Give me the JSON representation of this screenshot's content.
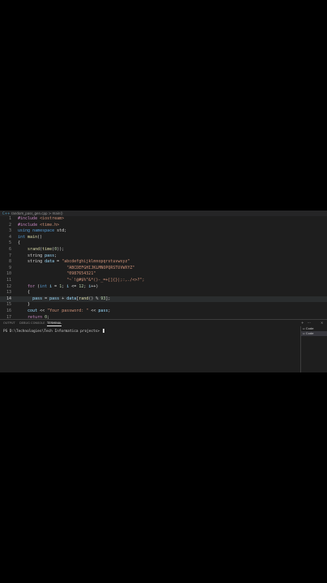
{
  "breadcrumb": {
    "file_icon": "C++",
    "file": "random_pass_gen.cpp",
    "separator": ">",
    "symbol": "main()"
  },
  "code_lines": [
    {
      "n": "1",
      "tokens": [
        {
          "c": "tok-dir",
          "t": "#include "
        },
        {
          "c": "tok-inc",
          "t": "<iostream>"
        }
      ]
    },
    {
      "n": "2",
      "tokens": [
        {
          "c": "tok-dir",
          "t": "#include "
        },
        {
          "c": "tok-inc",
          "t": "<time.h>"
        }
      ]
    },
    {
      "n": "3",
      "tokens": [
        {
          "c": "tok-kw",
          "t": "using "
        },
        {
          "c": "tok-kw",
          "t": "namespace "
        },
        {
          "c": "tok-plain",
          "t": "std;"
        }
      ]
    },
    {
      "n": "4",
      "tokens": [
        {
          "c": "tok-kw",
          "t": "int "
        },
        {
          "c": "tok-fn",
          "t": "main"
        },
        {
          "c": "tok-plain",
          "t": "()"
        }
      ]
    },
    {
      "n": "5",
      "tokens": [
        {
          "c": "tok-plain",
          "t": "{"
        }
      ]
    },
    {
      "n": "6",
      "tokens": [
        {
          "c": "tok-plain",
          "t": "    "
        },
        {
          "c": "tok-fn",
          "t": "srand"
        },
        {
          "c": "tok-plain",
          "t": "("
        },
        {
          "c": "tok-fn",
          "t": "time"
        },
        {
          "c": "tok-plain",
          "t": "("
        },
        {
          "c": "tok-num",
          "t": "0"
        },
        {
          "c": "tok-plain",
          "t": "));"
        }
      ]
    },
    {
      "n": "7",
      "tokens": [
        {
          "c": "tok-plain",
          "t": "    "
        },
        {
          "c": "tok-plain",
          "t": "string "
        },
        {
          "c": "tok-var",
          "t": "pass"
        },
        {
          "c": "tok-plain",
          "t": ";"
        }
      ]
    },
    {
      "n": "8",
      "tokens": [
        {
          "c": "tok-plain",
          "t": "    "
        },
        {
          "c": "tok-plain",
          "t": "string "
        },
        {
          "c": "tok-var",
          "t": "data"
        },
        {
          "c": "tok-plain",
          "t": " = "
        },
        {
          "c": "tok-str",
          "t": "\"abcdefghijklmnopqrstuvwxyz\""
        }
      ]
    },
    {
      "n": "9",
      "tokens": [
        {
          "c": "tok-plain",
          "t": "                    "
        },
        {
          "c": "tok-str",
          "t": "\"ABCDEFGHIJKLMNOPQRSTUVWXYZ\""
        }
      ]
    },
    {
      "n": "10",
      "tokens": [
        {
          "c": "tok-plain",
          "t": "                    "
        },
        {
          "c": "tok-str",
          "t": "\"0987654321\""
        }
      ]
    },
    {
      "n": "11",
      "tokens": [
        {
          "c": "tok-plain",
          "t": "                    "
        },
        {
          "c": "tok-str",
          "t": "\"~`!@#$%^&*()-_=+[]{}|;:,./<>?\";"
        }
      ]
    },
    {
      "n": "12",
      "tokens": [
        {
          "c": "tok-plain",
          "t": "    "
        },
        {
          "c": "tok-ctl",
          "t": "for "
        },
        {
          "c": "tok-plain",
          "t": "("
        },
        {
          "c": "tok-kw",
          "t": "int "
        },
        {
          "c": "tok-var",
          "t": "i"
        },
        {
          "c": "tok-plain",
          "t": " = "
        },
        {
          "c": "tok-num",
          "t": "1"
        },
        {
          "c": "tok-plain",
          "t": "; "
        },
        {
          "c": "tok-var",
          "t": "i"
        },
        {
          "c": "tok-plain",
          "t": " <= "
        },
        {
          "c": "tok-num",
          "t": "12"
        },
        {
          "c": "tok-plain",
          "t": "; "
        },
        {
          "c": "tok-var",
          "t": "i"
        },
        {
          "c": "tok-plain",
          "t": "++)"
        }
      ]
    },
    {
      "n": "13",
      "tokens": [
        {
          "c": "tok-plain",
          "t": "    {"
        }
      ]
    },
    {
      "n": "14",
      "active": true,
      "tokens": [
        {
          "c": "tok-plain",
          "t": "      "
        },
        {
          "c": "tok-var",
          "t": "pass"
        },
        {
          "c": "tok-plain",
          "t": " = "
        },
        {
          "c": "tok-var",
          "t": "pass"
        },
        {
          "c": "tok-plain",
          "t": " + "
        },
        {
          "c": "tok-var",
          "t": "data"
        },
        {
          "c": "tok-plain",
          "t": "["
        },
        {
          "c": "tok-fn",
          "t": "rand"
        },
        {
          "c": "tok-plain",
          "t": "() % "
        },
        {
          "c": "tok-num",
          "t": "93"
        },
        {
          "c": "tok-plain",
          "t": "];"
        }
      ]
    },
    {
      "n": "15",
      "tokens": [
        {
          "c": "tok-plain",
          "t": "    }"
        }
      ]
    },
    {
      "n": "16",
      "tokens": [
        {
          "c": "tok-plain",
          "t": "    "
        },
        {
          "c": "tok-var",
          "t": "cout"
        },
        {
          "c": "tok-plain",
          "t": " << "
        },
        {
          "c": "tok-str",
          "t": "\"Your password: \""
        },
        {
          "c": "tok-plain",
          "t": " << "
        },
        {
          "c": "tok-var",
          "t": "pass"
        },
        {
          "c": "tok-plain",
          "t": ";"
        }
      ]
    },
    {
      "n": "17",
      "tokens": [
        {
          "c": "tok-plain",
          "t": "    "
        },
        {
          "c": "tok-ctl",
          "t": "return "
        },
        {
          "c": "tok-num",
          "t": "0"
        },
        {
          "c": "tok-plain",
          "t": ";"
        }
      ]
    }
  ],
  "panel": {
    "tabs": [
      "OUTPUT",
      "DEBUG CONSOLE",
      "TERMINAL"
    ],
    "active_tab": 2,
    "controls": {
      "add": "+",
      "more": "···",
      "close": "×"
    }
  },
  "terminal": {
    "prompt": "PS D:\\Technologies\\Tech Informatica projects> "
  },
  "terminal_list": [
    {
      "label": "Code",
      "icon": "terminal-icon"
    },
    {
      "label": "Code",
      "icon": "terminal-icon",
      "active": true
    }
  ]
}
